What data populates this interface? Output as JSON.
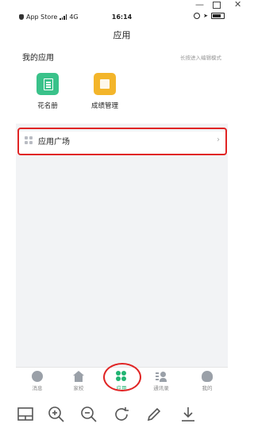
{
  "window": {
    "minimize": "—",
    "close": "✕"
  },
  "statusbar": {
    "carrier": "App Store",
    "network": "4G",
    "time": "16:14"
  },
  "navbar": {
    "title": "应用"
  },
  "my_apps": {
    "title": "我的应用",
    "hint": "长按进入编辑模式",
    "apps": [
      {
        "label": "花名册",
        "icon": "roster-icon",
        "color": "#3ac28a"
      },
      {
        "label": "成绩管理",
        "icon": "grades-icon",
        "color": "#f3b52a"
      }
    ]
  },
  "market": {
    "label": "应用广场",
    "chevron": "›"
  },
  "tabbar": {
    "tabs": [
      {
        "label": "消息",
        "icon": "message-icon"
      },
      {
        "label": "家校",
        "icon": "home-school-icon"
      },
      {
        "label": "应用",
        "icon": "apps-icon",
        "active": true
      },
      {
        "label": "通讯录",
        "icon": "contacts-icon"
      },
      {
        "label": "我的",
        "icon": "profile-icon"
      }
    ]
  },
  "toolbar": {
    "tools": [
      "layout-icon",
      "zoom-in-icon",
      "zoom-out-icon",
      "rotate-icon",
      "edit-icon",
      "download-icon"
    ]
  },
  "colors": {
    "accent": "#22b573",
    "highlight": "#e02424"
  }
}
